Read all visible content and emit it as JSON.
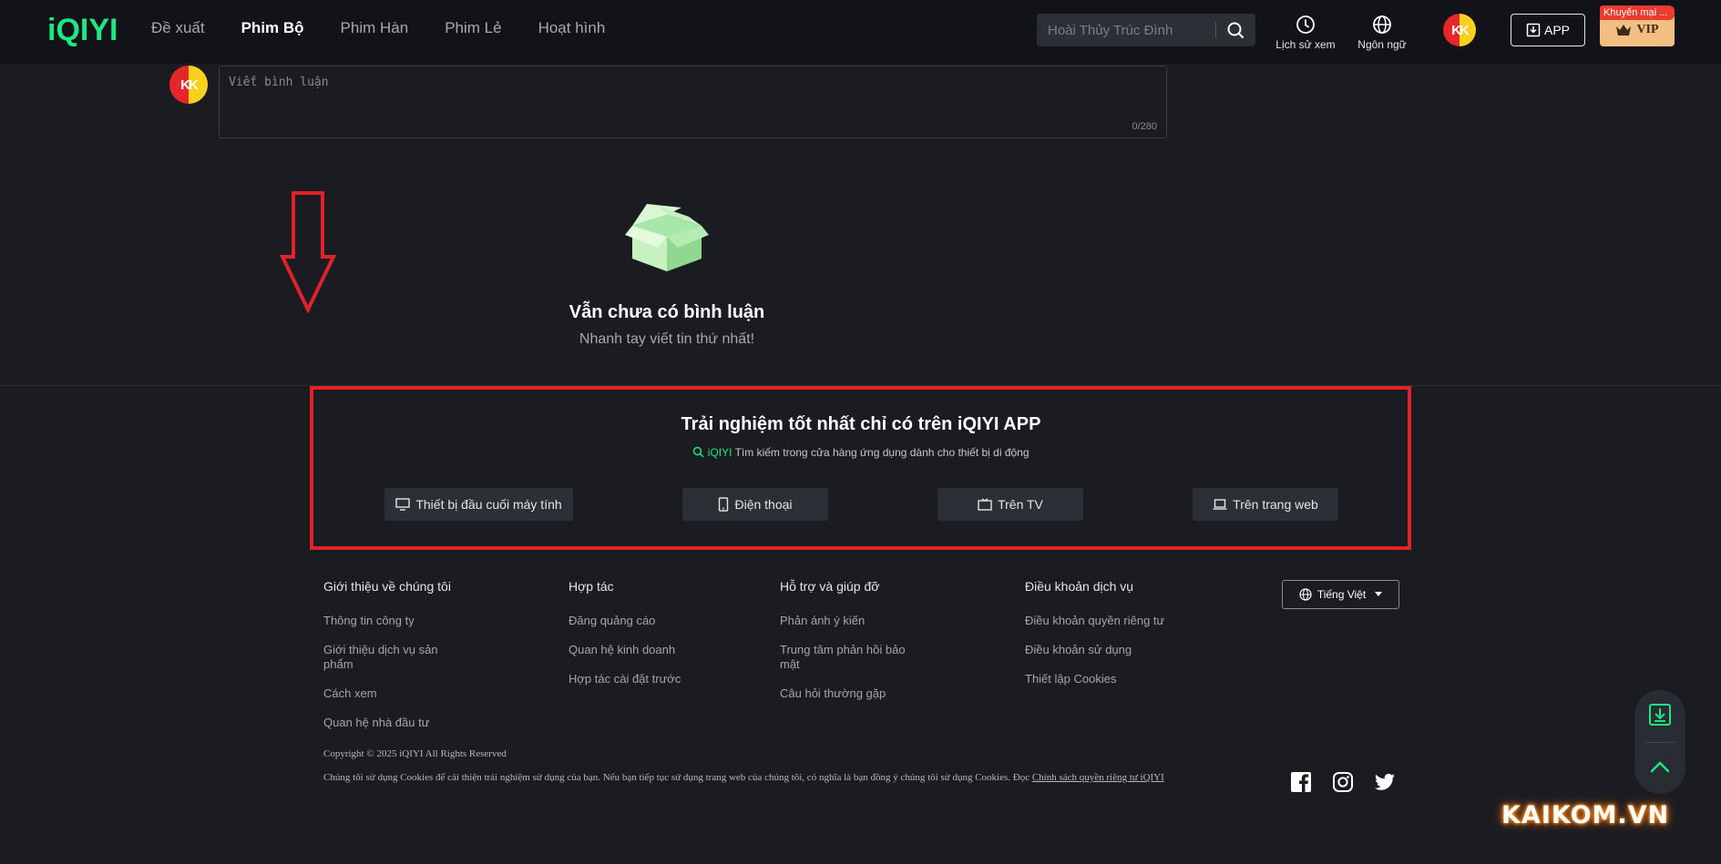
{
  "header": {
    "logo": "iQIYI",
    "nav": [
      "Đề xuất",
      "Phim Bộ",
      "Phim Hàn",
      "Phim Lẻ",
      "Hoạt hình"
    ],
    "active_nav": "Phim Bộ",
    "search_placeholder": "Hoài Thủy Trúc Đình",
    "history_label": "Lịch sử xem",
    "language_label": "Ngôn ngữ",
    "app_label": "APP",
    "vip_label": "VIP",
    "promo_label": "Khuyến mại ...",
    "avatar_text": "KK"
  },
  "comment": {
    "placeholder": "Viết bình luận",
    "counter": "0/280",
    "empty_title": "Vẫn chưa có bình luận",
    "empty_subtitle": "Nhanh tay viết tin thứ nhất!"
  },
  "app_promo": {
    "title": "Trải nghiệm tốt nhất chỉ có trên iQIYI APP",
    "search_brand": "iQIYI",
    "search_text": "Tìm kiếm trong cửa hàng ứng dụng dành cho thiết bị di động",
    "devices": [
      "Thiết bị đầu cuối máy tính",
      "Điện thoại",
      "Trên TV",
      "Trên trang web"
    ]
  },
  "footer": {
    "columns": [
      {
        "title": "Giới thiệu về chúng tôi",
        "links": [
          "Thông tin công ty",
          "Giới thiệu dịch vụ sản phẩm",
          "Cách xem",
          "Quan hệ nhà đầu tư"
        ]
      },
      {
        "title": "Hợp tác",
        "links": [
          "Đăng quảng cáo",
          "Quan hệ kinh doanh",
          "Hợp tác cài đặt trước"
        ]
      },
      {
        "title": "Hỗ trợ và giúp đỡ",
        "links": [
          "Phản ánh ý kiến",
          "Trung tâm phản hồi bảo mật",
          "Câu hỏi thường gặp"
        ]
      },
      {
        "title": "Điều khoản dịch vụ",
        "links": [
          "Điều khoản quyền riêng tư",
          "Điều khoản sử dụng",
          "Thiết lập Cookies"
        ]
      }
    ],
    "language_button": "Tiếng Việt",
    "copyright": "Copyright © 2025 iQIYI All Rights Reserved",
    "cookie_text": "Chúng tôi sử dụng Cookies để cải thiện trải nghiệm sử dụng của bạn. Nếu bạn tiếp tục sử dụng trang web của chúng tôi, có nghĩa là bạn đồng ý chúng tôi sử dụng Cookies. Đọc ",
    "cookie_link": "Chính sách quyền riêng tư iQIYI"
  },
  "watermark": "KAIKOM.VN"
}
